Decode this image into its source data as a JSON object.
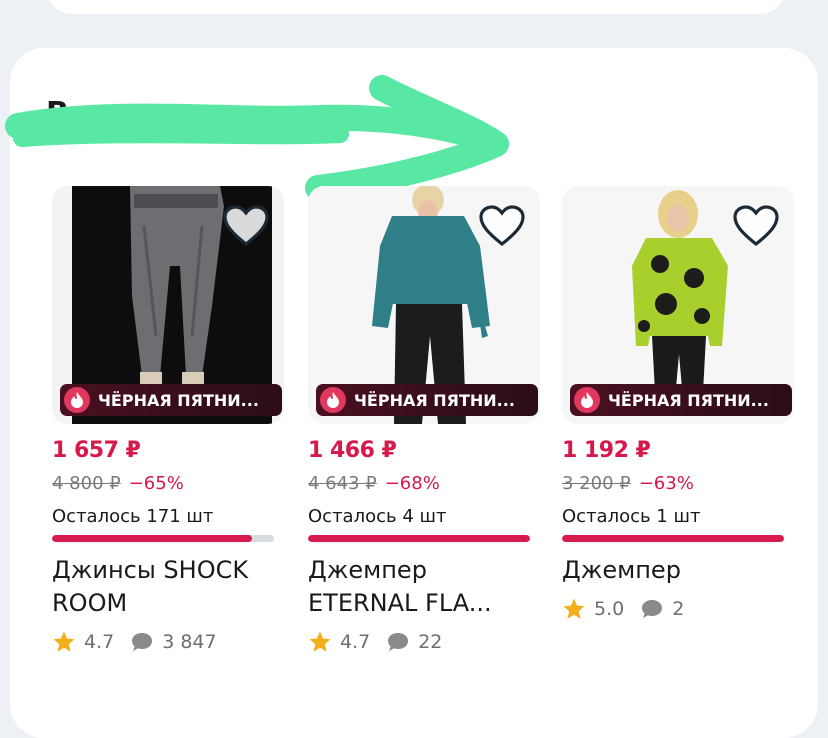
{
  "section": {
    "title": "Вы смотрели"
  },
  "colors": {
    "accent": "#d6194a",
    "badge_bg": "#2a0d16",
    "annotation": "#58e8a4"
  },
  "products": [
    {
      "image": "jeans-photo",
      "badge": "ЧЁРНАЯ ПЯТНИ...",
      "price": "1 657 ₽",
      "old_price": "4 800 ₽",
      "discount": "−65%",
      "stock": "Осталось 171 шт",
      "stock_fill": 0.9,
      "name": "Джинсы SHOCK ROOM",
      "rating": "4.7",
      "reviews": "3 847"
    },
    {
      "image": "teal-jumper-photo",
      "badge": "ЧЁРНАЯ ПЯТНИ...",
      "price": "1 466 ₽",
      "old_price": "4 643 ₽",
      "discount": "−68%",
      "stock": "Осталось 4 шт",
      "stock_fill": 1.0,
      "name": "Джемпер ETERNAL FLA...",
      "rating": "4.7",
      "reviews": "22"
    },
    {
      "image": "polka-jumper-photo",
      "badge": "ЧЁРНАЯ ПЯТНИ...",
      "price": "1 192 ₽",
      "old_price": "3 200 ₽",
      "discount": "−63%",
      "stock": "Осталось 1 шт",
      "stock_fill": 1.0,
      "name": "Джемпер",
      "rating": "5.0",
      "reviews": "2"
    }
  ]
}
